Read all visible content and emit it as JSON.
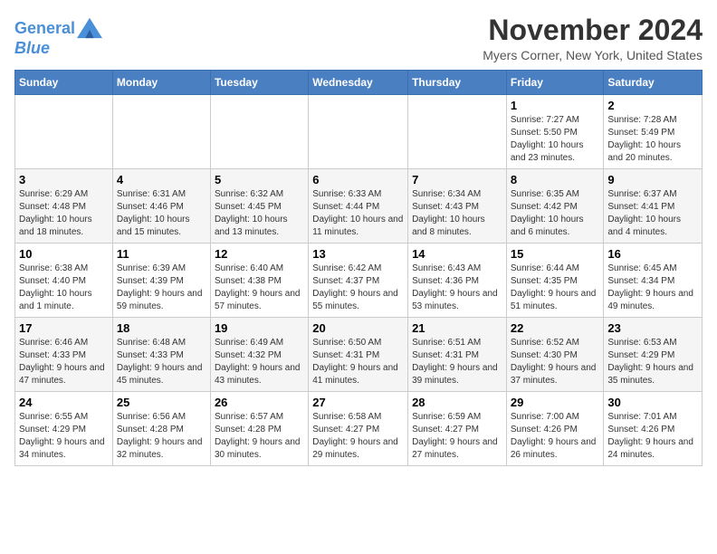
{
  "header": {
    "logo_line1": "General",
    "logo_line2": "Blue",
    "month_title": "November 2024",
    "location": "Myers Corner, New York, United States"
  },
  "weekdays": [
    "Sunday",
    "Monday",
    "Tuesday",
    "Wednesday",
    "Thursday",
    "Friday",
    "Saturday"
  ],
  "weeks": [
    [
      {
        "day": "",
        "info": ""
      },
      {
        "day": "",
        "info": ""
      },
      {
        "day": "",
        "info": ""
      },
      {
        "day": "",
        "info": ""
      },
      {
        "day": "",
        "info": ""
      },
      {
        "day": "1",
        "info": "Sunrise: 7:27 AM\nSunset: 5:50 PM\nDaylight: 10 hours and 23 minutes."
      },
      {
        "day": "2",
        "info": "Sunrise: 7:28 AM\nSunset: 5:49 PM\nDaylight: 10 hours and 20 minutes."
      }
    ],
    [
      {
        "day": "3",
        "info": "Sunrise: 6:29 AM\nSunset: 4:48 PM\nDaylight: 10 hours and 18 minutes."
      },
      {
        "day": "4",
        "info": "Sunrise: 6:31 AM\nSunset: 4:46 PM\nDaylight: 10 hours and 15 minutes."
      },
      {
        "day": "5",
        "info": "Sunrise: 6:32 AM\nSunset: 4:45 PM\nDaylight: 10 hours and 13 minutes."
      },
      {
        "day": "6",
        "info": "Sunrise: 6:33 AM\nSunset: 4:44 PM\nDaylight: 10 hours and 11 minutes."
      },
      {
        "day": "7",
        "info": "Sunrise: 6:34 AM\nSunset: 4:43 PM\nDaylight: 10 hours and 8 minutes."
      },
      {
        "day": "8",
        "info": "Sunrise: 6:35 AM\nSunset: 4:42 PM\nDaylight: 10 hours and 6 minutes."
      },
      {
        "day": "9",
        "info": "Sunrise: 6:37 AM\nSunset: 4:41 PM\nDaylight: 10 hours and 4 minutes."
      }
    ],
    [
      {
        "day": "10",
        "info": "Sunrise: 6:38 AM\nSunset: 4:40 PM\nDaylight: 10 hours and 1 minute."
      },
      {
        "day": "11",
        "info": "Sunrise: 6:39 AM\nSunset: 4:39 PM\nDaylight: 9 hours and 59 minutes."
      },
      {
        "day": "12",
        "info": "Sunrise: 6:40 AM\nSunset: 4:38 PM\nDaylight: 9 hours and 57 minutes."
      },
      {
        "day": "13",
        "info": "Sunrise: 6:42 AM\nSunset: 4:37 PM\nDaylight: 9 hours and 55 minutes."
      },
      {
        "day": "14",
        "info": "Sunrise: 6:43 AM\nSunset: 4:36 PM\nDaylight: 9 hours and 53 minutes."
      },
      {
        "day": "15",
        "info": "Sunrise: 6:44 AM\nSunset: 4:35 PM\nDaylight: 9 hours and 51 minutes."
      },
      {
        "day": "16",
        "info": "Sunrise: 6:45 AM\nSunset: 4:34 PM\nDaylight: 9 hours and 49 minutes."
      }
    ],
    [
      {
        "day": "17",
        "info": "Sunrise: 6:46 AM\nSunset: 4:33 PM\nDaylight: 9 hours and 47 minutes."
      },
      {
        "day": "18",
        "info": "Sunrise: 6:48 AM\nSunset: 4:33 PM\nDaylight: 9 hours and 45 minutes."
      },
      {
        "day": "19",
        "info": "Sunrise: 6:49 AM\nSunset: 4:32 PM\nDaylight: 9 hours and 43 minutes."
      },
      {
        "day": "20",
        "info": "Sunrise: 6:50 AM\nSunset: 4:31 PM\nDaylight: 9 hours and 41 minutes."
      },
      {
        "day": "21",
        "info": "Sunrise: 6:51 AM\nSunset: 4:31 PM\nDaylight: 9 hours and 39 minutes."
      },
      {
        "day": "22",
        "info": "Sunrise: 6:52 AM\nSunset: 4:30 PM\nDaylight: 9 hours and 37 minutes."
      },
      {
        "day": "23",
        "info": "Sunrise: 6:53 AM\nSunset: 4:29 PM\nDaylight: 9 hours and 35 minutes."
      }
    ],
    [
      {
        "day": "24",
        "info": "Sunrise: 6:55 AM\nSunset: 4:29 PM\nDaylight: 9 hours and 34 minutes."
      },
      {
        "day": "25",
        "info": "Sunrise: 6:56 AM\nSunset: 4:28 PM\nDaylight: 9 hours and 32 minutes."
      },
      {
        "day": "26",
        "info": "Sunrise: 6:57 AM\nSunset: 4:28 PM\nDaylight: 9 hours and 30 minutes."
      },
      {
        "day": "27",
        "info": "Sunrise: 6:58 AM\nSunset: 4:27 PM\nDaylight: 9 hours and 29 minutes."
      },
      {
        "day": "28",
        "info": "Sunrise: 6:59 AM\nSunset: 4:27 PM\nDaylight: 9 hours and 27 minutes."
      },
      {
        "day": "29",
        "info": "Sunrise: 7:00 AM\nSunset: 4:26 PM\nDaylight: 9 hours and 26 minutes."
      },
      {
        "day": "30",
        "info": "Sunrise: 7:01 AM\nSunset: 4:26 PM\nDaylight: 9 hours and 24 minutes."
      }
    ]
  ]
}
